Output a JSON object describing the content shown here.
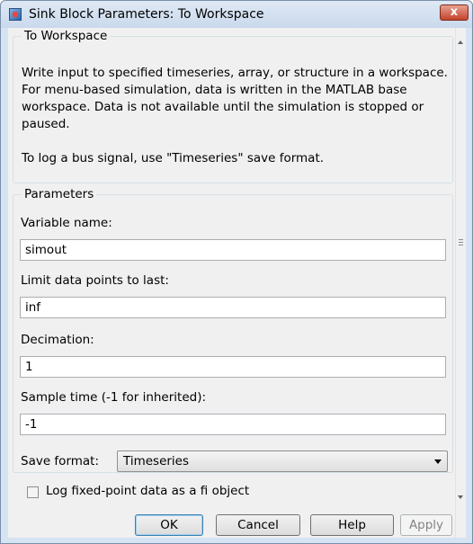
{
  "window": {
    "title": "Sink Block Parameters: To Workspace",
    "close_glyph": "x",
    "colors": {
      "frame": "#d6e3f2",
      "close": "#c4432c",
      "client": "#f0f0f0"
    }
  },
  "block": {
    "group_title": "To Workspace",
    "description": [
      "Write input to specified timeseries, array, or structure in a workspace. For menu-based simulation, data is written in the MATLAB base workspace. Data is not available until the simulation is stopped or paused.",
      "To log a bus signal, use \"Timeseries\" save format."
    ]
  },
  "parameters": {
    "group_title": "Parameters",
    "variable_name": {
      "label": "Variable name:",
      "value": "simout"
    },
    "limit_points": {
      "label": "Limit data points to last:",
      "value": "inf"
    },
    "decimation": {
      "label": "Decimation:",
      "value": "1"
    },
    "sample_time": {
      "label": "Sample time (-1 for inherited):",
      "value": "-1"
    },
    "save_format": {
      "label": "Save format:",
      "selected": "Timeseries"
    },
    "fixed_point": {
      "label": "Log fixed-point data as a fi object",
      "checked": false
    }
  },
  "buttons": {
    "ok": "OK",
    "cancel": "Cancel",
    "help": "Help",
    "apply": "Apply",
    "apply_enabled": false
  },
  "icons": {
    "app": "simulink-block-icon",
    "close": "close-icon",
    "dropdown": "chevron-down-icon"
  }
}
